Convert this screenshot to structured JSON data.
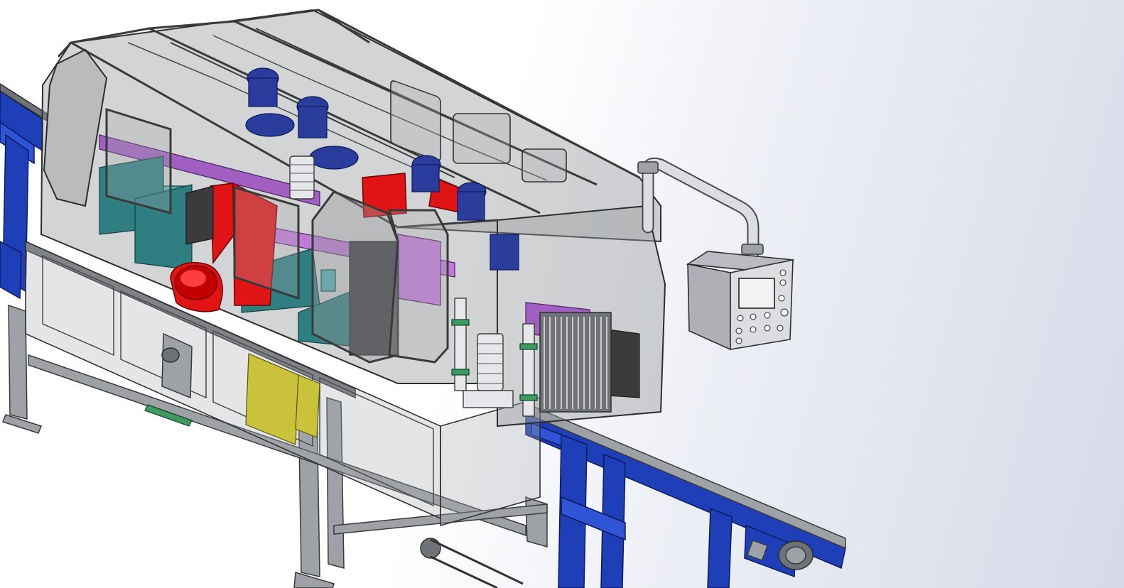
{
  "viewport": {
    "background_gradient": [
      "#ffffff",
      "#d6dae8"
    ]
  },
  "model": {
    "components": [
      {
        "name": "transparent-enclosure",
        "color": "#96989c"
      },
      {
        "name": "steel-base-frame",
        "color": "#9ea1a6"
      },
      {
        "name": "infeed-conveyor",
        "color": "#1f3fb8"
      },
      {
        "name": "outfeed-conveyor",
        "color": "#1f3fb8"
      },
      {
        "name": "dust-extraction-hood",
        "color": "#e01414"
      },
      {
        "name": "motor-spindles",
        "color": "#2a3c9c"
      },
      {
        "name": "chip-chutes",
        "color": "#2f7f82"
      },
      {
        "name": "purple-mounting-plates",
        "color": "#a25fc2"
      },
      {
        "name": "yellow-collection-bins",
        "color": "#c9c23a"
      },
      {
        "name": "control-panel-box",
        "color": "#dcdde0"
      },
      {
        "name": "cable-conduit-pipe",
        "color": "#dcdde0"
      }
    ]
  },
  "control_panel": {
    "header_text": "",
    "screen": "display-screen"
  }
}
